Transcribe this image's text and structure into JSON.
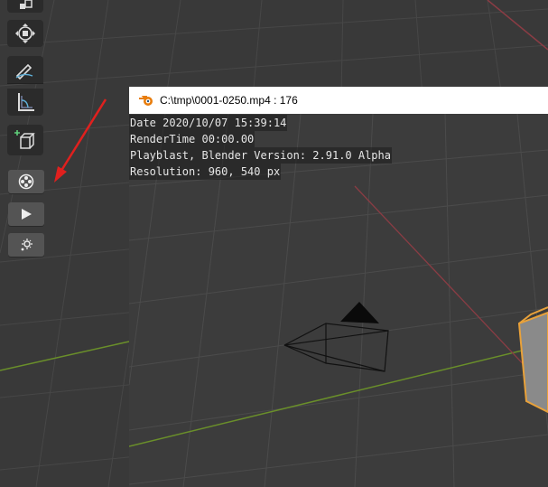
{
  "viewer": {
    "title": "C:\\tmp\\0001-0250.mp4 :  176",
    "overlay": [
      "Date 2020/10/07 15:39:14",
      "RenderTime 00:00.00",
      "Playblast, Blender Version: 2.91.0 Alpha",
      "Resolution: 960, 540 px"
    ]
  },
  "toolbar": {
    "tools": [
      "scale-tool",
      "transform-tool",
      "annotate-tool",
      "measure-tool",
      "add-cube-tool"
    ],
    "buttons": [
      "playblast-render-button",
      "play-button",
      "settings-button"
    ]
  },
  "colors": {
    "viewport_bg": "#393939",
    "grid": "#474747",
    "x_axis": "#8a3c44",
    "y_axis": "#6a8f2a",
    "arrow": "#e0201e",
    "selection": "#e8a13a"
  }
}
